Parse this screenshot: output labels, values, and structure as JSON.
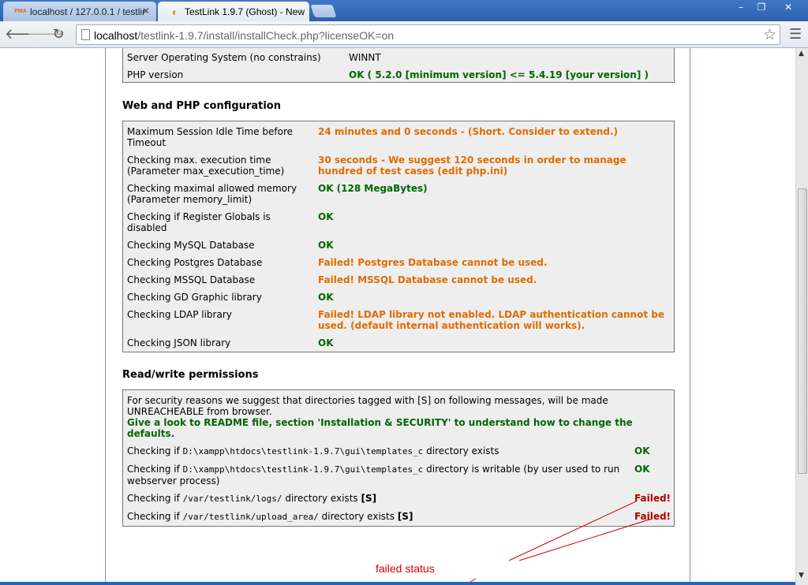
{
  "browser": {
    "tabs": [
      {
        "label": "localhost / 127.0.0.1 / testlir",
        "favicon": "PMA",
        "active": false
      },
      {
        "label": "TestLink 1.9.7 (Ghost) - New",
        "active": true
      }
    ],
    "url_host": "localhost",
    "url_path": "/testlink-1.9.7/install/installCheck.php?licenseOK=on"
  },
  "system": {
    "rows": [
      {
        "label": "Server Operating System (no constrains)",
        "value": "WINNT"
      },
      {
        "label": "PHP version",
        "value": "OK ( 5.2.0 [minimum version] <= 5.4.19 [your version] )"
      }
    ]
  },
  "webphp": {
    "heading": "Web and PHP configuration",
    "rows": [
      {
        "label": "Maximum Session Idle Time before Timeout",
        "value": "24 minutes and 0 seconds - (Short. Consider to extend.)",
        "status": "warn"
      },
      {
        "label": "Checking max. execution time (Parameter max_execution_time)",
        "value": "30 seconds - We suggest 120 seconds in order to manage hundred of test cases (edit php.ini)",
        "status": "warn"
      },
      {
        "label": "Checking maximal allowed memory (Parameter memory_limit)",
        "value": "OK (128 MegaBytes)",
        "status": "ok"
      },
      {
        "label": "Checking if Register Globals is disabled",
        "value": "OK",
        "status": "ok"
      },
      {
        "label": "Checking MySQL Database",
        "value": "OK",
        "status": "ok"
      },
      {
        "label": "Checking Postgres Database",
        "value": "Failed! Postgres Database cannot be used.",
        "status": "warn"
      },
      {
        "label": "Checking MSSQL Database",
        "value": "Failed! MSSQL Database cannot be used.",
        "status": "warn"
      },
      {
        "label": "Checking GD Graphic library",
        "value": "OK",
        "status": "ok"
      },
      {
        "label": "Checking LDAP library",
        "value": "Failed! LDAP library not enabled. LDAP authentication cannot be used. (default internal authentication will works).",
        "status": "warn"
      },
      {
        "label": "Checking JSON library",
        "value": "OK",
        "status": "ok"
      }
    ]
  },
  "perms": {
    "heading": "Read/write permissions",
    "intro": "For security reasons we suggest that directories tagged with [S] on following messages, will be made UNREACHEABLE from browser.",
    "readme": "Give a look to README file, section 'Installation & SECURITY' to understand how to change the defaults.",
    "rows": [
      {
        "pre": "Checking if ",
        "path": "D:\\xampp\\htdocs\\testlink-1.9.7\\gui\\templates_c",
        "post": " directory exists",
        "tag": "",
        "status_text": "OK",
        "status": "ok"
      },
      {
        "pre": "Checking if ",
        "path": "D:\\xampp\\htdocs\\testlink-1.9.7\\gui\\templates_c",
        "post": " directory is writable (by user used to run webserver process)",
        "tag": "",
        "status_text": "OK",
        "status": "ok"
      },
      {
        "pre": "Checking if ",
        "path": "/var/testlink/logs/",
        "post": " directory exists ",
        "tag": "[S]",
        "status_text": "Failed!",
        "status": "fail"
      },
      {
        "pre": "Checking if ",
        "path": "/var/testlink/upload_area/",
        "post": " directory exists ",
        "tag": "[S]",
        "status_text": "Failed!",
        "status": "fail"
      }
    ]
  },
  "annotation": {
    "text": "failed status"
  },
  "colors": {
    "ok": "#006600",
    "warn": "#e06c00",
    "fail": "#b30000",
    "annotation": "#cc0000"
  }
}
